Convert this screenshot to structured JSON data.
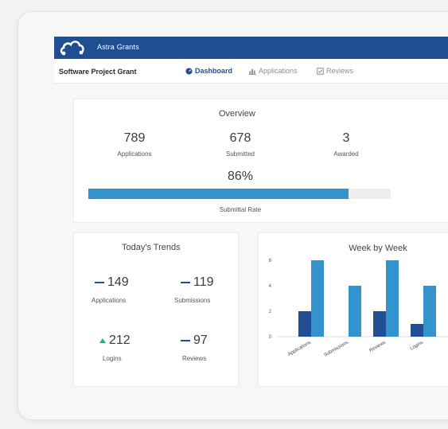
{
  "app": {
    "brand": "Astra Grants",
    "project": "Software Project Grant"
  },
  "nav": {
    "tabs": [
      {
        "label": "Dashboard",
        "icon": "dashboard-icon",
        "active": true
      },
      {
        "label": "Applications",
        "icon": "applications-icon",
        "active": false
      },
      {
        "label": "Reviews",
        "icon": "reviews-icon",
        "active": false
      }
    ]
  },
  "overview": {
    "title": "Overview",
    "stats": [
      {
        "value": "789",
        "label": "Applications"
      },
      {
        "value": "678",
        "label": "Submitted"
      },
      {
        "value": "3",
        "label": "Awarded"
      }
    ],
    "rate_value": "86%",
    "rate_fraction": 0.86,
    "rate_label": "Submittal Rate"
  },
  "trends": {
    "title": "Today's Trends",
    "items": [
      {
        "value": "149",
        "label": "Applications",
        "indicator": "flat"
      },
      {
        "value": "119",
        "label": "Submissions",
        "indicator": "flat"
      },
      {
        "value": "212",
        "label": "Logins",
        "indicator": "up"
      },
      {
        "value": "97",
        "label": "Reviews",
        "indicator": "flat"
      }
    ]
  },
  "colors": {
    "brand": "#1f4f92",
    "accent": "#3492cc",
    "up": "#2fb36b"
  },
  "chart_data": {
    "type": "bar",
    "title": "Week by Week",
    "categories": [
      "Applications",
      "Submissions",
      "Reviews",
      "Logins"
    ],
    "series": [
      {
        "color": "#1f4f92",
        "values": [
          2,
          null,
          2,
          1
        ]
      },
      {
        "color": "#3492cc",
        "values": [
          6,
          4,
          6,
          4
        ]
      }
    ],
    "yticks": [
      0,
      2,
      4,
      6
    ],
    "ylim": [
      0,
      6
    ]
  }
}
